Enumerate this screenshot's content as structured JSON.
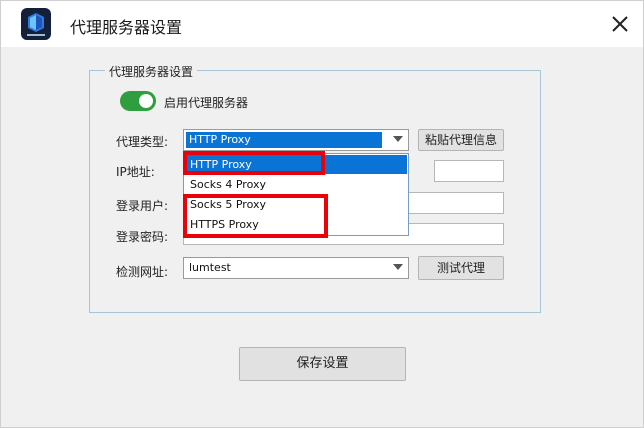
{
  "window": {
    "title": "代理服务器设置"
  },
  "group": {
    "legend": "代理服务器设置"
  },
  "enable_proxy": {
    "label": "启用代理服务器",
    "on": true
  },
  "form": {
    "proxy_type_label": "代理类型:",
    "proxy_type_value": "HTTP Proxy",
    "paste_button": "粘贴代理信息",
    "ip_label": "IP地址:",
    "user_label": "登录用户:",
    "password_label": "登录密码:",
    "check_url_label": "检测网址:",
    "check_url_value": "lumtest",
    "test_button": "测试代理"
  },
  "dropdown": {
    "options": [
      "HTTP Proxy",
      "Socks 4 Proxy",
      "Socks 5 Proxy",
      "HTTPS Proxy"
    ],
    "highlighted": "HTTP Proxy"
  },
  "save_button": "保存设置",
  "colors": {
    "accent": "#0a74d6",
    "toggle_on": "#2e9e3f",
    "annotation_red": "#e8000b",
    "group_border": "#a9c4d6"
  },
  "icons": {
    "logo": "app-logo-icon",
    "close": "close-icon",
    "dropdown_arrow": "chevron-down-icon"
  }
}
